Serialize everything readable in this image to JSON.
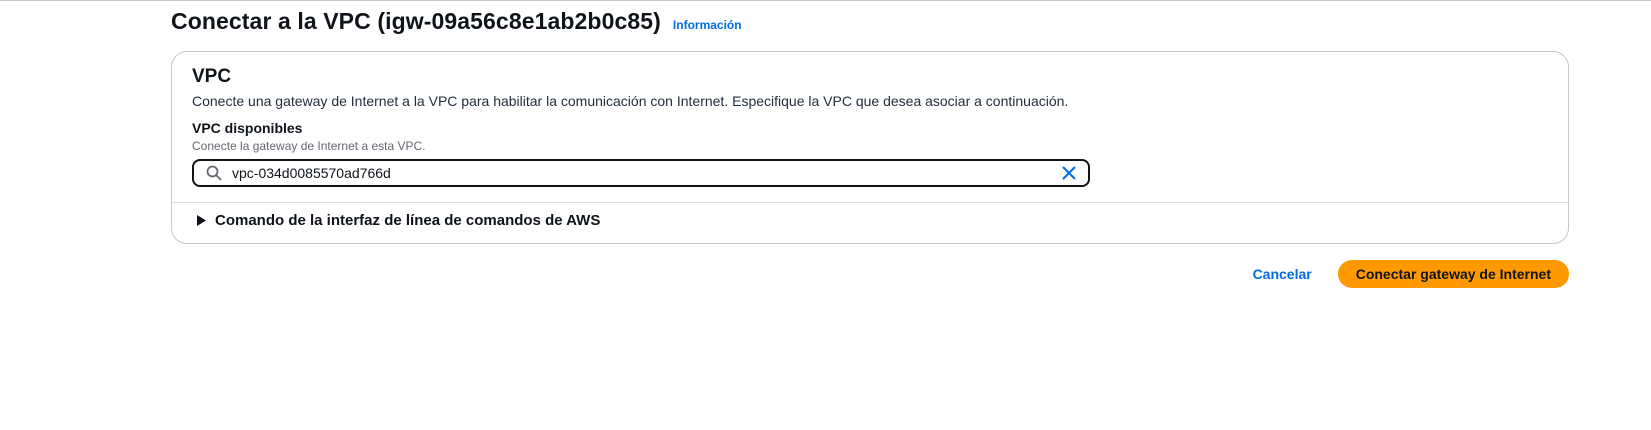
{
  "header": {
    "title": "Conectar a la VPC (igw-09a56c8e1ab2b0c85)",
    "info_link": "Información"
  },
  "panel": {
    "title": "VPC",
    "description": "Conecte una gateway de Internet a la VPC para habilitar la comunicación con Internet. Especifique la VPC que desea asociar a continuación.",
    "field": {
      "label": "VPC disponibles",
      "description": "Conecte la gateway de Internet a esta VPC.",
      "value": "vpc-034d0085570ad766d",
      "icons": [
        "search-icon",
        "close-icon"
      ]
    },
    "expander": {
      "label": "Comando de la interfaz de línea de comandos de AWS",
      "icon": "caret-right-icon"
    }
  },
  "actions": {
    "cancel_label": "Cancelar",
    "primary_label": "Conectar gateway de Internet"
  },
  "colors": {
    "link": "#006ce0",
    "primary_button": "#ff9900",
    "text": "#0f141a",
    "border": "#c6c6cd"
  }
}
